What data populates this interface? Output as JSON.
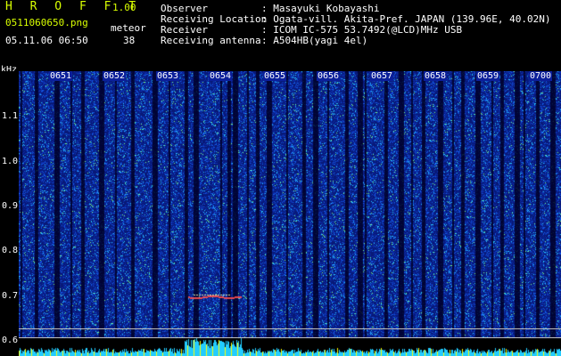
{
  "header": {
    "logo": "H R O F F T",
    "version": "1.00",
    "filename": "0511060650.png",
    "meteor_label": "meteor",
    "datetime": "05.11.06 06:50",
    "meteor_count": "38"
  },
  "info": {
    "observer_label": "Observer",
    "observer": ": Masayuki Kobayashi",
    "location_label": "Receiving Location",
    "location": ": Ogata-vill. Akita-Pref. JAPAN (139.96E, 40.02N)",
    "receiver_label": "Receiver",
    "receiver": ": ICOM IC-575 53.7492(@LCD)MHz USB",
    "antenna_label": "Receiving antenna",
    "antenna": ": A504HB(yagi 4el)"
  },
  "axis": {
    "unit": "kHz",
    "yticks": [
      "1.1",
      "1.0",
      "0.9",
      "0.8",
      "0.7",
      "0.6"
    ],
    "times": [
      "0651",
      "0652",
      "0653",
      "0654",
      "0655",
      "0656",
      "0657",
      "0658",
      "0659",
      "0700"
    ]
  },
  "colors": {
    "background": "#0b1f9a",
    "accent": "#d9ff00"
  }
}
